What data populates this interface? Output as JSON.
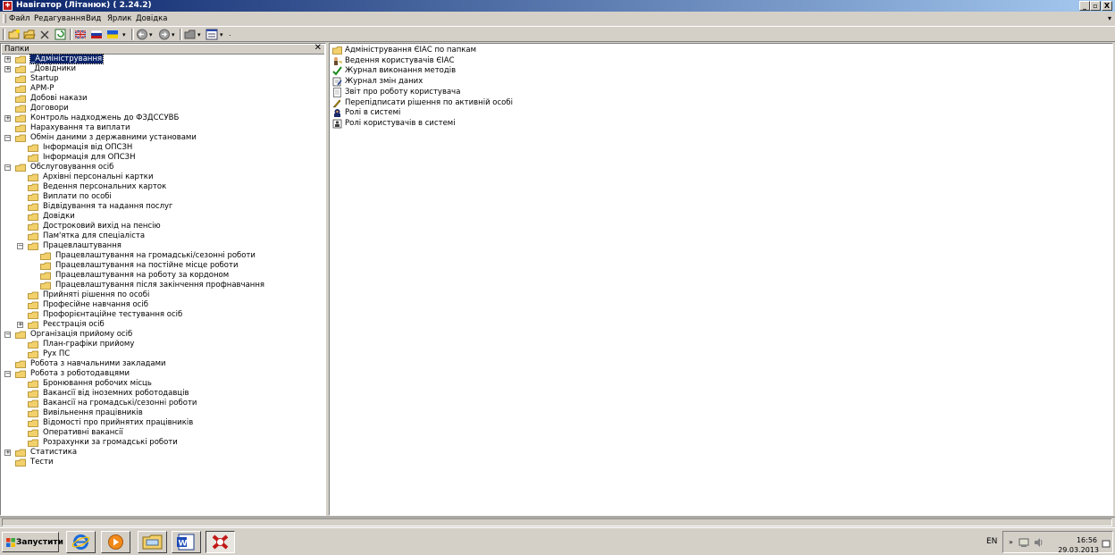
{
  "window": {
    "title": "Навігатор (Літанюк) ( 2.24.2)",
    "min_label": "_",
    "max_label": "▫",
    "close_label": "X",
    "mdi_min": "_",
    "mdi_max": "▫",
    "mdi_close": "X"
  },
  "menu": [
    {
      "label": "Файл"
    },
    {
      "label": "Редагування"
    },
    {
      "label": "Вид"
    },
    {
      "label": "Ярлик"
    },
    {
      "label": "Довідка"
    }
  ],
  "left_pane": {
    "header": "Папки",
    "close_label": "✕"
  },
  "tree": [
    {
      "label": "_Адміністрування",
      "level": 0,
      "expander": "+",
      "selected": true
    },
    {
      "label": "_Довідники",
      "level": 0,
      "expander": "+"
    },
    {
      "label": "Startup",
      "level": 0
    },
    {
      "label": "АРМ-Р",
      "level": 0
    },
    {
      "label": "Добові накази",
      "level": 0
    },
    {
      "label": "Договори",
      "level": 0
    },
    {
      "label": "Контроль надходжень до ФЗДССУВБ",
      "level": 0,
      "expander": "+"
    },
    {
      "label": "Нарахування та виплати",
      "level": 0
    },
    {
      "label": "Обмін даними з державними установами",
      "level": 0,
      "expander": "−"
    },
    {
      "label": "Інформація від ОПСЗН",
      "level": 1
    },
    {
      "label": "Інформація для ОПСЗН",
      "level": 1
    },
    {
      "label": "Обслуговування осіб",
      "level": 0,
      "expander": "−"
    },
    {
      "label": "Архівні персональні картки",
      "level": 1
    },
    {
      "label": "Ведення персональних карток",
      "level": 1
    },
    {
      "label": "Виплати по особі",
      "level": 1
    },
    {
      "label": "Відвідування та надання послуг",
      "level": 1
    },
    {
      "label": "Довідки",
      "level": 1
    },
    {
      "label": "Достроковий вихід на пенсію",
      "level": 1
    },
    {
      "label": "Пам'ятка для спеціаліста",
      "level": 1
    },
    {
      "label": "Працевлаштування",
      "level": 1,
      "expander": "−"
    },
    {
      "label": "Працевлаштування на громадські/сезонні роботи",
      "level": 2
    },
    {
      "label": "Працевлаштування на постійне місце роботи",
      "level": 2
    },
    {
      "label": "Працевлаштування на роботу за кордоном",
      "level": 2
    },
    {
      "label": "Працевлаштування після закінчення профнавчання",
      "level": 2
    },
    {
      "label": "Прийняті рішення по особі",
      "level": 1
    },
    {
      "label": "Професійне навчання осіб",
      "level": 1
    },
    {
      "label": "Профорієнтаційне тестування осіб",
      "level": 1
    },
    {
      "label": "Реєстрація осіб",
      "level": 1,
      "expander": "+"
    },
    {
      "label": "Організація прийому осіб",
      "level": 0,
      "expander": "−"
    },
    {
      "label": "План-графіки прийому",
      "level": 1
    },
    {
      "label": "Рух ПС",
      "level": 1
    },
    {
      "label": "Робота з навчальними закладами",
      "level": 0
    },
    {
      "label": "Робота з роботодавцями",
      "level": 0,
      "expander": "−"
    },
    {
      "label": "Бронювання робочих місць",
      "level": 1
    },
    {
      "label": "Вакансії від іноземних роботодавців",
      "level": 1
    },
    {
      "label": "Вакансії на громадські/сезонні роботи",
      "level": 1
    },
    {
      "label": "Вивільнення працівників",
      "level": 1
    },
    {
      "label": "Відомості про прийнятих працівників",
      "level": 1
    },
    {
      "label": "Оперативні вакансії",
      "level": 1
    },
    {
      "label": "Розрахунки за громадські роботи",
      "level": 1
    },
    {
      "label": "Статистика",
      "level": 0,
      "expander": "+"
    },
    {
      "label": "Тести",
      "level": 0
    }
  ],
  "items": [
    {
      "label": "Адміністрування ЄІАС по папкам",
      "icon": "folder-icon"
    },
    {
      "label": "Ведення користувачів ЄІАС",
      "icon": "user-key-icon"
    },
    {
      "label": "Журнал виконання методів",
      "icon": "checkmark-icon"
    },
    {
      "label": "Журнал змін даних",
      "icon": "edit-log-icon"
    },
    {
      "label": "Звіт про роботу користувача",
      "icon": "report-icon"
    },
    {
      "label": "Перепідписати рішення по активній особі",
      "icon": "resign-icon"
    },
    {
      "label": "Ролі в системі",
      "icon": "roles-icon"
    },
    {
      "label": "Ролі користувачів в системі",
      "icon": "user-roles-icon"
    }
  ],
  "taskbar": {
    "start_label": "Запустити",
    "lang": "EN",
    "time": "16:56",
    "date": "29.03.2013",
    "apps": [
      {
        "name": "internet-explorer-icon"
      },
      {
        "name": "media-player-icon"
      },
      {
        "name": "explorer-folder-icon"
      },
      {
        "name": "word-icon"
      },
      {
        "name": "navigator-app-icon"
      }
    ]
  },
  "colors": {
    "title_start": "#0a246a",
    "title_end": "#a6caf0",
    "folder": "#f2d06b",
    "selection": "#0a246a"
  }
}
